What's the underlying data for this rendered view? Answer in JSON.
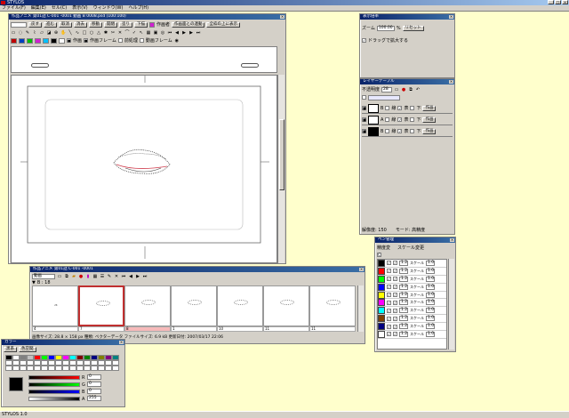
{
  "app": {
    "title": "STYLOS"
  },
  "menu": [
    "ファイル(F)",
    "編集(E)",
    "セル(C)",
    "表示(V)",
    "ウィンドウ(W)",
    "ヘルプ(H)"
  ],
  "status": {
    "text": "STYLOS 1.0"
  },
  "canvas": {
    "title": "作品アニメ 第01話 C-001 -0001 動画 B 0008.psd (100:100)",
    "toolbar_row1": [
      "戻す",
      "進む",
      "取消",
      "消去",
      "移動",
      "開閉",
      "塗り",
      "下描",
      "作画者",
      "作画面との連動",
      "全枠の上に表示"
    ],
    "toolbar_row3": [
      "作画",
      "作画フレーム",
      "前処理",
      "動画フレーム"
    ],
    "colors": {
      "red": "#c00000",
      "blue": "#0040c0",
      "magenta": "#d020d0",
      "cyan": "#00c0ff",
      "green": "#00c000"
    }
  },
  "timeline": {
    "title": "作品アニメ 第01話 C-001 -0001",
    "layer_select": "動画",
    "frame_label": "B : 18",
    "frame_numbers": [
      "4",
      "7",
      "8",
      "1",
      "10",
      "11",
      "11"
    ],
    "info": "画像サイズ: 28.8 × 158 px    種類: ベクターデータ    ファイルサイズ: 6.9 kB    更新日付: 2007/03/17 22:06"
  },
  "color": {
    "title": "カラー",
    "tabs": [
      "黒系",
      "色空間"
    ],
    "labels": {
      "r": "R",
      "g": "G",
      "b": "B",
      "a": "A"
    },
    "values": {
      "r": "0",
      "g": "0",
      "b": "0",
      "a": "255"
    },
    "current": "#000000",
    "palette_colors": [
      "#000000",
      "#ffffff",
      "#808080",
      "#c0c0c0",
      "#ff0000",
      "#00ff00",
      "#0000ff",
      "#ffff00",
      "#ff00ff",
      "#00ffff",
      "#800000",
      "#008000",
      "#000080",
      "#808000",
      "#800080",
      "#008080"
    ]
  },
  "zoom": {
    "title": "表示倍率",
    "zoom_label": "ズーム",
    "zoom_value": "100.00",
    "unit": "%",
    "reset": "リセット",
    "drag_label": "ドラッグで拡大する"
  },
  "layers": {
    "title": "レイヤーテーブル",
    "opacity_label": "不透明度",
    "opacity_value": "28",
    "rows": [
      {
        "name": "B",
        "flags": [
          "線",
          "表",
          "下",
          "作画"
        ]
      },
      {
        "name": "A",
        "flags": [
          "線",
          "表",
          "下",
          "作画"
        ]
      },
      {
        "name": "B",
        "flags": [
          "線",
          "表",
          "下",
          "作画"
        ]
      }
    ],
    "footer_left": "解像度: 150",
    "footer_right": "モード: 高精度"
  },
  "pen": {
    "title": "ペン管理",
    "tabs": [
      "精度変",
      "スケール変更"
    ],
    "scale_label": "スケール",
    "rows": [
      {
        "color": "#000000",
        "size": "1.2",
        "scale": "1.0"
      },
      {
        "color": "#ff0000",
        "size": "1.2",
        "scale": "1.0"
      },
      {
        "color": "#00ff00",
        "size": "1.2",
        "scale": "1.0"
      },
      {
        "color": "#0000ff",
        "size": "1.2",
        "scale": "1.0"
      },
      {
        "color": "#ffff00",
        "size": "1.2",
        "scale": "1.0"
      },
      {
        "color": "#ff00ff",
        "size": "1.2",
        "scale": "1.0"
      },
      {
        "color": "#00ffff",
        "size": "1.2",
        "scale": "1.0"
      },
      {
        "color": "#804000",
        "size": "1.2",
        "scale": "1.0"
      },
      {
        "color": "#000080",
        "size": "1.2",
        "scale": "1.0"
      },
      {
        "color": "#ffffff",
        "size": "1.2",
        "scale": "1.0"
      }
    ]
  }
}
